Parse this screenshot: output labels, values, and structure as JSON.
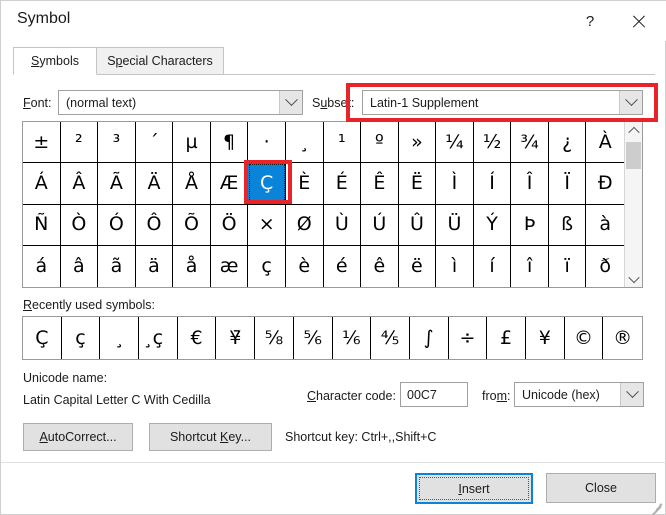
{
  "window": {
    "title": "Symbol",
    "help_icon": "question-mark-icon",
    "close_icon": "close-icon"
  },
  "tabs": [
    {
      "label": "Symbols",
      "active": true
    },
    {
      "label": "Special Characters",
      "active": false
    }
  ],
  "font_row": {
    "font_label": "Font:",
    "font_value": "(normal text)",
    "subset_label": "Subset:",
    "subset_value": "Latin-1 Supplement",
    "highlight_color": "#e8232a"
  },
  "grid": {
    "selected_index": 22,
    "selected_char": "Ç",
    "selection_color": "#0a84d8",
    "cells": [
      "±",
      "²",
      "³",
      "´",
      "µ",
      "¶",
      "·",
      "¸",
      "¹",
      "º",
      "»",
      "¼",
      "½",
      "¾",
      "¿",
      "À",
      "Á",
      "Â",
      "Ã",
      "Ä",
      "Å",
      "Æ",
      "Ç",
      "È",
      "É",
      "Ê",
      "Ë",
      "Ì",
      "Í",
      "Î",
      "Ï",
      "Ð",
      "Ñ",
      "Ò",
      "Ó",
      "Ô",
      "Õ",
      "Ö",
      "×",
      "Ø",
      "Ù",
      "Ú",
      "Û",
      "Ü",
      "Ý",
      "Þ",
      "ß",
      "à",
      "á",
      "â",
      "ã",
      "ä",
      "å",
      "æ",
      "ç",
      "è",
      "é",
      "ê",
      "ë",
      "ì",
      "í",
      "î",
      "ï",
      "ð"
    ]
  },
  "recent": {
    "label": "Recently used symbols:",
    "cells": [
      "Ç",
      "ç",
      "¸",
      "̧ç",
      "€",
      "¥̄",
      "⅝",
      "⅚",
      "⅙",
      "⅘",
      "∫",
      "÷",
      "£",
      "¥",
      "©",
      "®"
    ]
  },
  "details": {
    "unicode_name_label": "Unicode name:",
    "unicode_name_value": "Latin Capital Letter C With Cedilla",
    "character_code_label": "Character code:",
    "character_code_value": "00C7",
    "from_label": "from:",
    "from_value": "Unicode (hex)"
  },
  "actions": {
    "autocorrect_label": "AutoCorrect...",
    "shortcut_key_label": "Shortcut Key...",
    "shortcut_note": "Shortcut key: Ctrl+,,Shift+C",
    "insert_label": "Insert",
    "close_label": "Close"
  }
}
